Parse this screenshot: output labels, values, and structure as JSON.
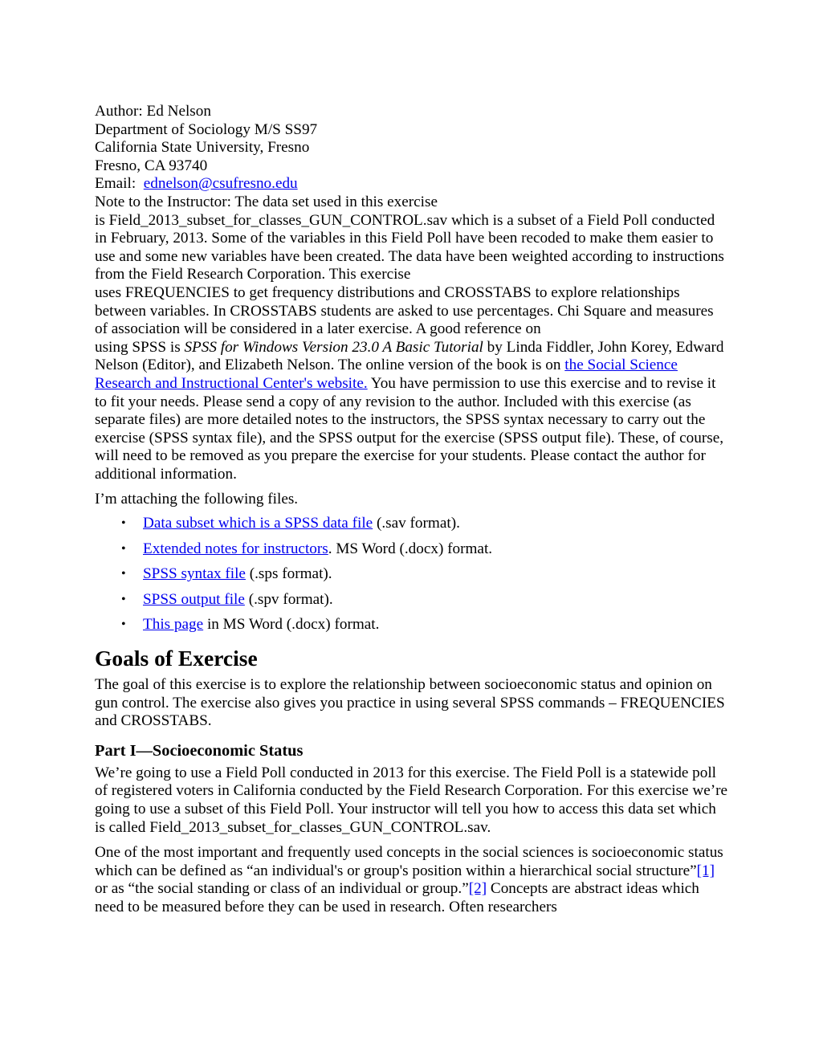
{
  "document": {
    "author_block": {
      "line1": "Author:   Ed Nelson",
      "line2": "Department of Sociology M/S SS97",
      "line3": "California State University, Fresno",
      "line4": "Fresno, CA 93740",
      "email_label": "Email:",
      "email_link": "ednelson@csufresno.edu"
    },
    "note_paragraph": {
      "part1": "Note to the Instructor: The data set used in this exercise",
      "part2": "is Field_2013_subset_for_classes_GUN_CONTROL.sav which is a subset of a Field Poll conducted in February, 2013.  Some of the variables in this Field Poll have been recoded to make them easier to use and some new variables have been created.  The data have been weighted according to instructions from the Field Research Corporation.  This exercise",
      "part3": "uses FREQUENCIES to get frequency distributions and CROSSTABS to explore relationships between variables.  In CROSSTABS students are asked to use percentages.  Chi Square and measures of association will be considered in a later exercise.  A good reference on",
      "part4": "using SPSS is ",
      "book_title_italic": "SPSS for Windows Version 23.0 A Basic Tutorial",
      "part5": " by Linda Fiddler, John Korey, Edward Nelson (Editor), and Elizabeth Nelson.  The online version of the book is on ",
      "ssric_link": "the Social Science Research and Instructional Center's website.",
      "part6": "  You have permission to use this exercise and to revise it to fit your needs.  Please send a copy of any revision to the author. Included with this exercise (as separate files) are more detailed notes to the instructors, the SPSS syntax necessary to carry out the exercise (SPSS syntax file), and the SPSS output for the exercise (SPSS output file). These, of course, will need to be removed as you prepare the exercise for your students.  Please contact the author for additional information."
    },
    "attaching_line": "I’m attaching the following files.",
    "file_list": {
      "bullet_glyph": "•",
      "items": [
        {
          "link": "Data subset which is a SPSS data file",
          "rest": " (.sav format)."
        },
        {
          "link": "Extended notes for instructors",
          "rest": ". MS Word (.docx) format."
        },
        {
          "link": "SPSS syntax file",
          "rest": " (.sps format)."
        },
        {
          "link": "SPSS output file",
          "rest": " (.spv format)."
        },
        {
          "link": "This page",
          "rest": " in MS Word (.docx) format."
        }
      ]
    },
    "goals": {
      "heading": "Goals of Exercise",
      "body": "The goal of this exercise is to explore the relationship between socioeconomic status and opinion on gun control.  The exercise also gives you practice in using several SPSS commands – FREQUENCIES and CROSSTABS."
    },
    "part_one": {
      "heading": "Part I—Socioeconomic Status",
      "paragraph1": "We’re going to use a Field Poll conducted in 2013 for this exercise.  The Field Poll is a statewide poll of registered voters in California conducted by the Field Research Corporation.  For this exercise we’re going to use a subset of this Field Poll. Your instructor will tell you how to access this data set which is called Field_2013_subset_for_classes_GUN_CONTROL.sav.",
      "paragraph2_a": "One of the most important and frequently used concepts in the social sciences is socioeconomic status which can be defined as “an individual's or group's position within a hierarchical social structure”",
      "footnote1": "[1]",
      "paragraph2_b": " or as “the social standing or class of an individual or group.”",
      "footnote2": "[2]",
      "paragraph2_c": "  Concepts are abstract ideas which need to be measured before they can be used in research.  Often researchers"
    }
  }
}
